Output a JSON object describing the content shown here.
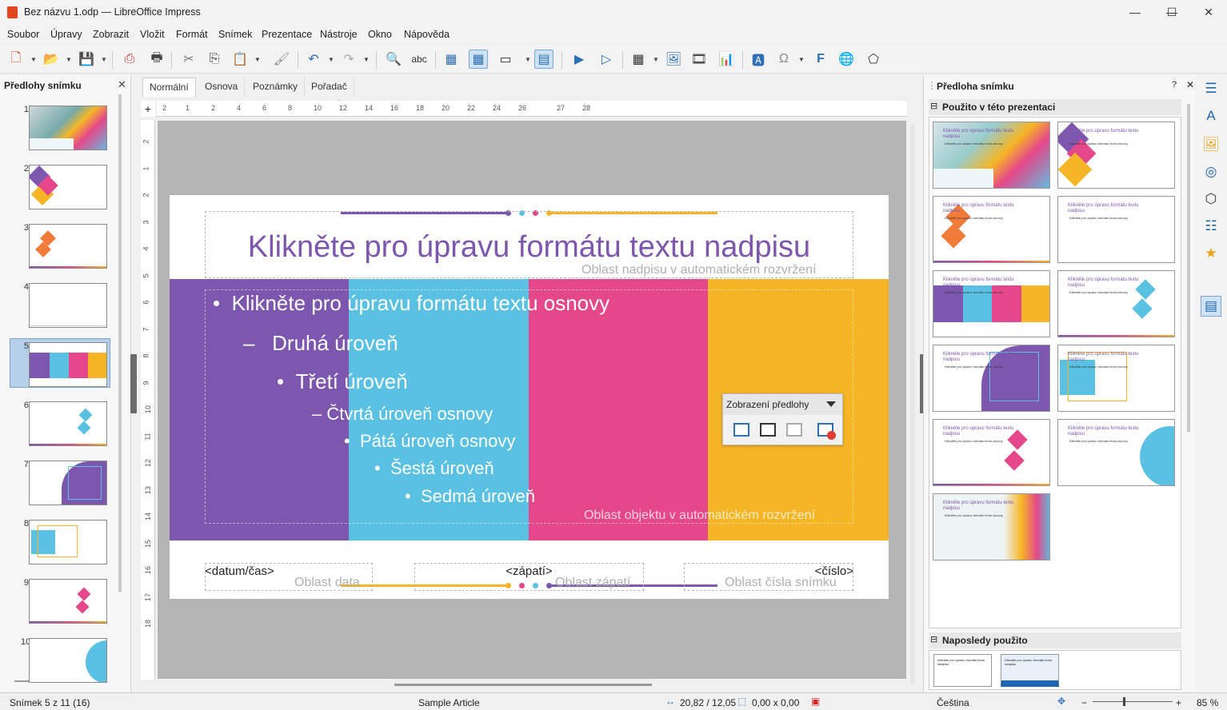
{
  "window": {
    "title": "Bez názvu 1.odp — LibreOffice Impress",
    "min": "—",
    "max": "☐",
    "close": "✕"
  },
  "menu": [
    "Soubor",
    "Úpravy",
    "Zobrazit",
    "Vložit",
    "Formát",
    "Snímek",
    "Prezentace",
    "Nástroje",
    "Okno",
    "Nápověda"
  ],
  "slide_pane": {
    "header": "Předlohy snímku",
    "close": "✕",
    "slide_numbers": [
      "1",
      "2",
      "3",
      "4",
      "5",
      "6",
      "7",
      "8",
      "9",
      "10"
    ],
    "selected_slide": 5
  },
  "view_tabs": [
    "Normální",
    "Osnova",
    "Poznámky",
    "Pořadač snímků"
  ],
  "ruler": {
    "h_ticks": [
      "2",
      "1",
      "2",
      "4",
      "6",
      "8",
      "10",
      "12",
      "14",
      "16",
      "18",
      "20",
      "22",
      "24",
      "26",
      "27",
      "28"
    ],
    "v_ticks": [
      "2",
      "1",
      "2",
      "3",
      "4",
      "5",
      "6",
      "7",
      "8",
      "9",
      "10",
      "11",
      "12",
      "13",
      "14",
      "15",
      "16",
      "17",
      "18"
    ]
  },
  "slide": {
    "title": "Klikněte pro úpravu formátu textu nadpisu",
    "title_area_label": "Oblast nadpisu v automatickém rozvržení",
    "outline": {
      "l1": "Klikněte pro úpravu formátu textu osnovy",
      "l2": "Druhá úroveň",
      "l3": "Třetí úroveň",
      "l4": "Čtvrtá úroveň osnovy",
      "l5": "Pátá úroveň osnovy",
      "l6": "Šestá úroveň",
      "l7": "Sedmá úroveň"
    },
    "object_area_label": "Oblast objektu v automatickém rozvržení",
    "footer": {
      "date": "<datum/čas>",
      "date_label": "Oblast data",
      "footer": "<zápatí>",
      "footer_label": "Oblast zápatí",
      "number": "<číslo>",
      "number_label": "Oblast čísla snímku"
    },
    "colors": {
      "purple": "#7d57ae",
      "blue": "#5bc1e3",
      "pink": "#e5488a",
      "yellow": "#f6b524"
    }
  },
  "floating_toolbar": {
    "title": "Zobrazení předlohy"
  },
  "master_pane": {
    "header": "Předloha snímku",
    "section_used": "Použito v této prezentaci",
    "section_recent": "Naposledy použito",
    "help": "?",
    "close": "✕",
    "thumb_title": "Klikněte pro úpravu formátu textu nadpisu",
    "thumb_outline": "Klikněte pro úpravu formátu textu osnovy",
    "recent_thumb": "Klikněte pro úpravu formátu textu nadpisu"
  },
  "statusbar": {
    "slide": "Snímek 5 z 11 (16)",
    "master": "Sample Article",
    "position": "20,82 / 12,05",
    "size": "0,00 x 0,00",
    "language": "Čeština",
    "zoom": "85 %",
    "zoom_minus": "−",
    "zoom_plus": "+"
  }
}
